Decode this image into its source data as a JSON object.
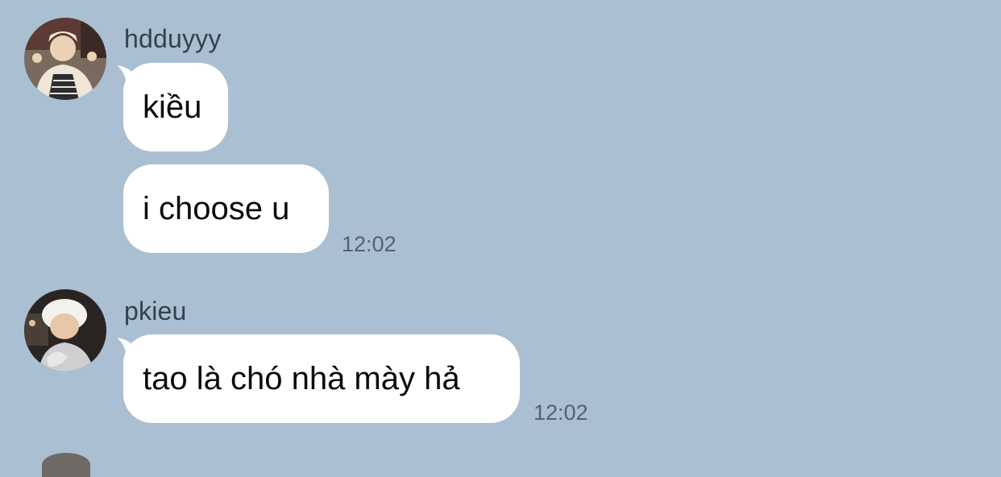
{
  "messages": [
    {
      "sender": "hdduyyy",
      "avatar_icon": "user-avatar-hdduyyy",
      "bubbles": [
        "kiều",
        "i choose u"
      ],
      "time": "12:02"
    },
    {
      "sender": "pkieu",
      "avatar_icon": "user-avatar-pkieu",
      "bubbles": [
        "tao là chó nhà mày hả"
      ],
      "time": "12:02"
    }
  ],
  "colors": {
    "background": "#aabfd2",
    "bubble": "#ffffff",
    "sender_text": "#36404b",
    "time_text": "#56616d"
  }
}
